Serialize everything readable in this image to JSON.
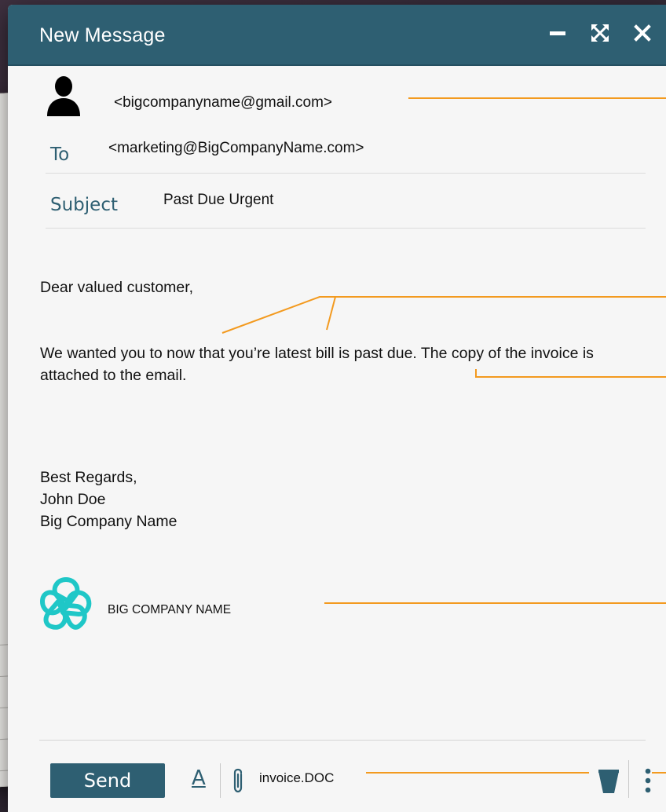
{
  "window": {
    "title": "New Message",
    "controls": [
      "minimize-icon",
      "expand-icon",
      "close-icon"
    ]
  },
  "header": {
    "from": "<bigcompanyname@gmail.com>",
    "to_label": "To",
    "to_value": "<marketing@BigCompanyName.com>",
    "subject_label": "Subject",
    "subject_value": "Past Due Urgent"
  },
  "body": {
    "greeting": "Dear valued customer,",
    "paragraph": "We wanted you to now that you’re latest bill is past due. The copy of the invoice is attached to the email.",
    "signoff": [
      "Best Regards,",
      "John Doe",
      "Big Company Name"
    ]
  },
  "signature": {
    "company_caption": "BIG COMPANY NAME"
  },
  "toolbar": {
    "send_label": "Send",
    "format_label": "A",
    "attachment_name": "invoice.DOC",
    "icons": [
      "format-text-icon",
      "paperclip-icon",
      "trash-icon",
      "more-vertical-icon"
    ]
  },
  "colors": {
    "accent": "#2e5f72",
    "callout": "#f39a1f",
    "logo": "#1fc7c7",
    "background": "#2f2733",
    "window_bg": "#f6f6f6"
  }
}
